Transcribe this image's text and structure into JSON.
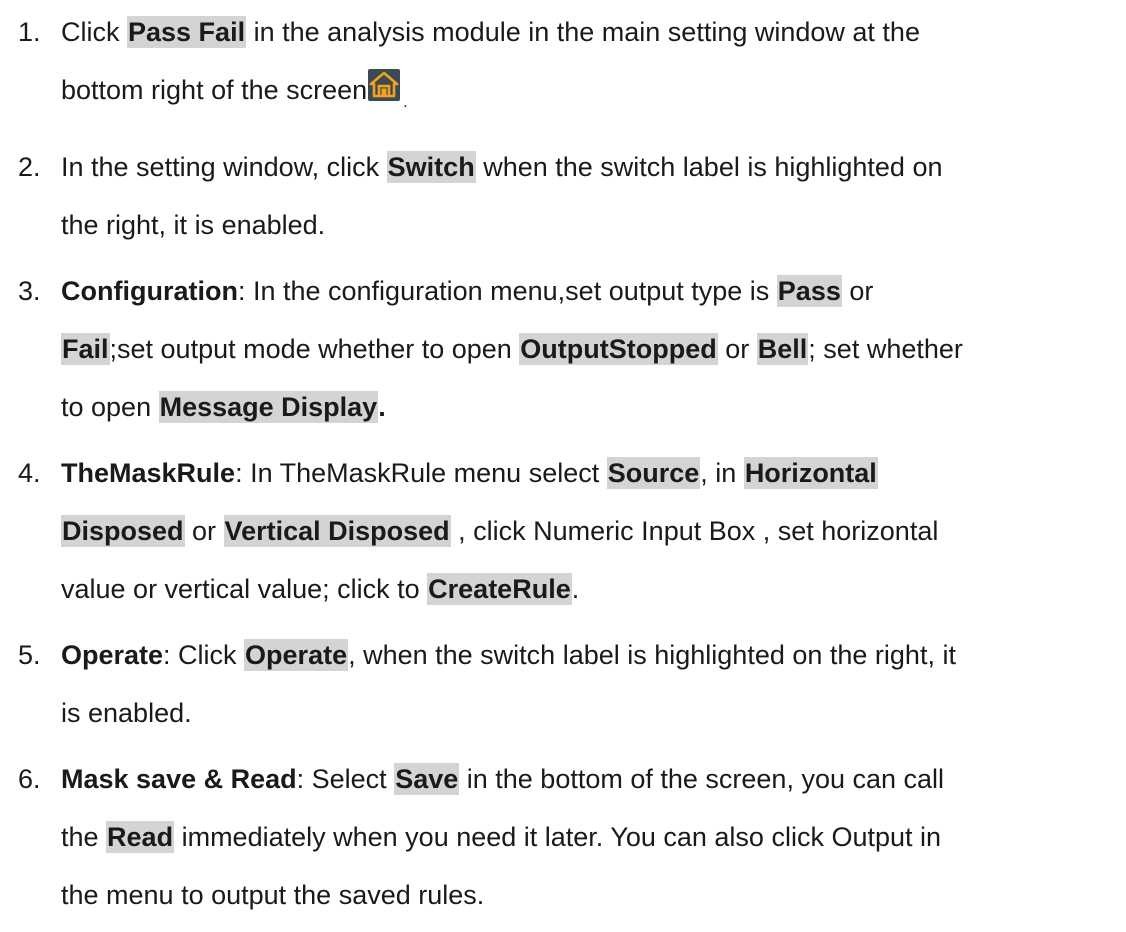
{
  "steps": [
    {
      "num": "1.",
      "line1_a": "Click ",
      "hl_pass_fail": "Pass Fail",
      "line1_b": " in the analysis module in the main setting window at the",
      "line2_a": "bottom right of the screen",
      "home_icon": "home-icon",
      "trail": "."
    },
    {
      "num": "2.",
      "a": "In the setting window, click ",
      "hl_switch": "Switch",
      "b": " when the switch label is highlighted on",
      "c": "the right, it is enabled."
    },
    {
      "num": "3.",
      "title": "Configuration",
      "a": ": In the configuration menu,set output type is ",
      "hl_pass": "Pass",
      "b": " or",
      "hl_fail": "Fail",
      "c": ";set output mode whether to open ",
      "hl_output_stopped": "OutputStopped",
      "d": " or ",
      "hl_bell": "Bell",
      "e": "; set whether",
      "f": "to open ",
      "hl_message_display": "Message Display",
      "g": "."
    },
    {
      "num": "4.",
      "title": "TheMaskRule",
      "a": ": In TheMaskRule menu select ",
      "hl_source": "Source",
      "b": ", in ",
      "hl_horizontal": "Horizontal",
      "hl_disposed": "Disposed",
      "c": " or ",
      "hl_vertical_disposed": "Vertical Disposed",
      "d": " , click Numeric Input Box , set horizontal",
      "e": "value or vertical value; click to ",
      "hl_create_rule": "CreateRule",
      "f": "."
    },
    {
      "num": "5.",
      "title": "Operate",
      "a": ": Click ",
      "hl_operate": "Operate",
      "b": ", when the switch label is highlighted on the right, it",
      "c": "is enabled."
    },
    {
      "num": "6.",
      "title": "Mask save & Read",
      "a": ": Select ",
      "hl_save": "Save",
      "b": " in the bottom of the screen, you can call",
      "c": "the ",
      "hl_read": "Read",
      "d": " immediately when you need it later. You can also click Output in",
      "e": "the menu to output the saved rules."
    }
  ],
  "colors": {
    "highlight": "#d4d4d4",
    "text": "#1a1a1a",
    "icon_bg": "#3c4a55",
    "icon_fg": "#f2a31b"
  }
}
